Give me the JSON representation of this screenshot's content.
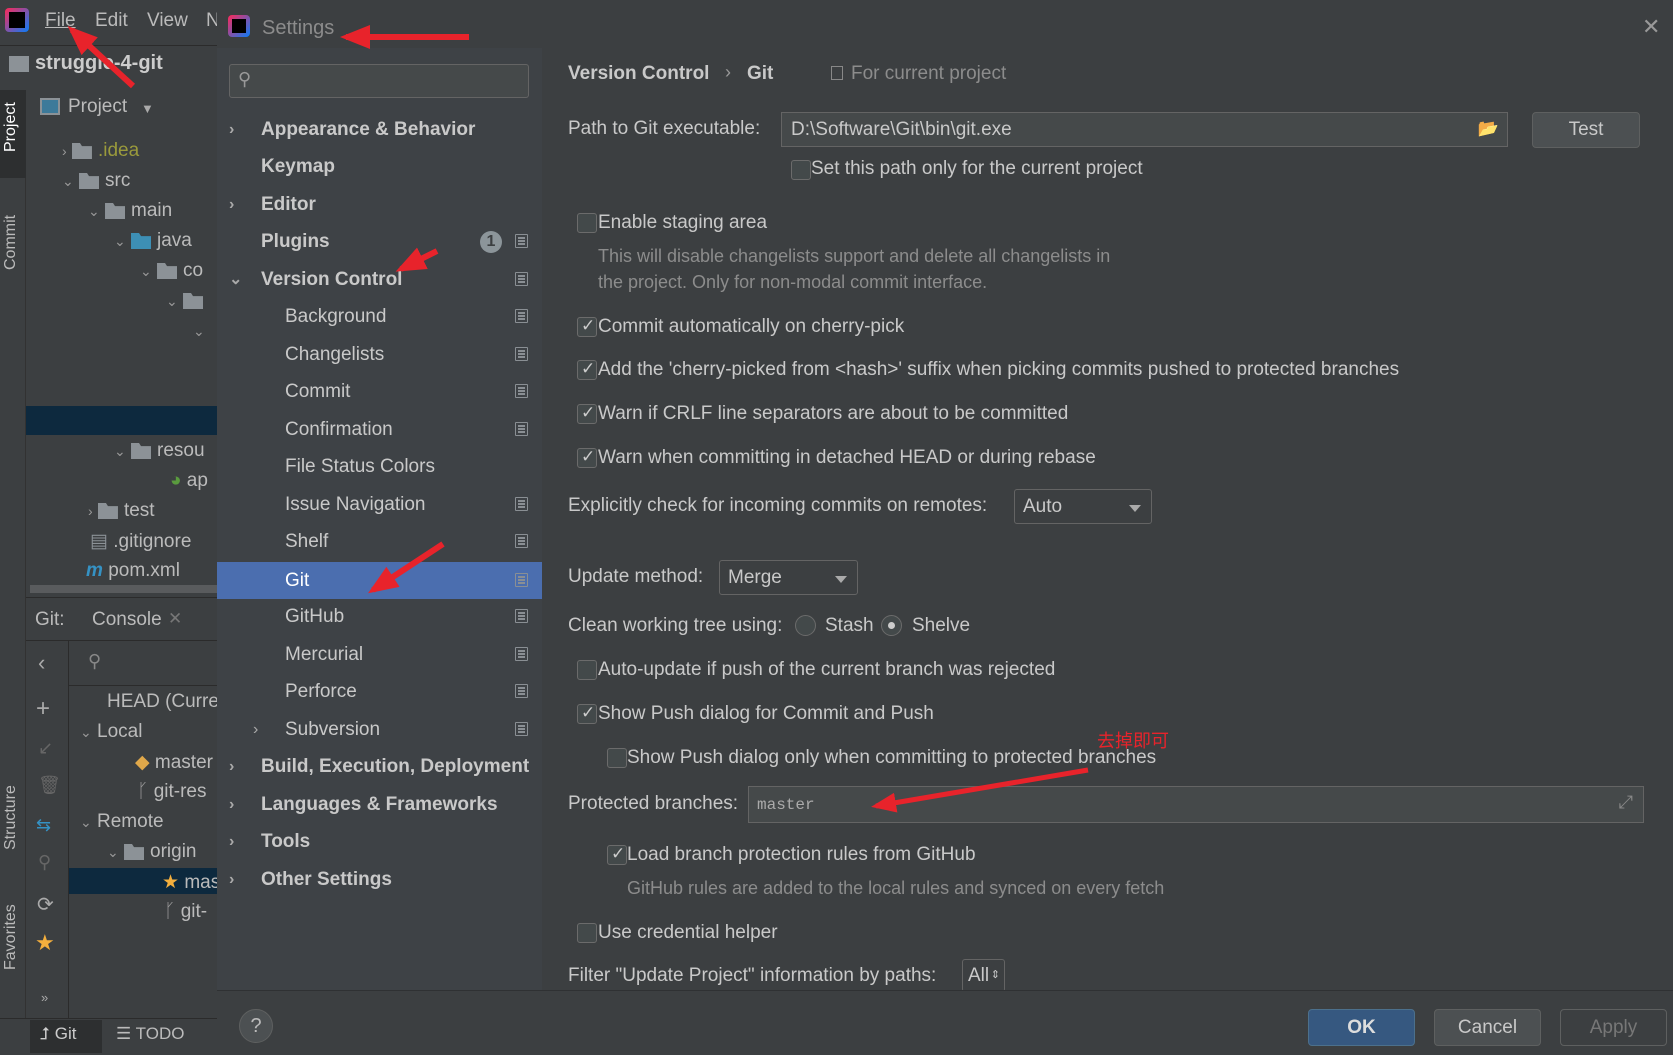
{
  "ide": {
    "menu": [
      "File",
      "Edit",
      "View",
      "N"
    ],
    "project_name": "struggle-4-git",
    "tool_strip": {
      "project": "Project",
      "commit": "Commit",
      "structure": "Structure",
      "favorites": "Favorites"
    },
    "project_view_label": "Project",
    "tree": [
      ".idea",
      "src",
      "main",
      "java",
      "co",
      "resou",
      "ap",
      "test",
      ".gitignore",
      "pom.xml"
    ],
    "git_panel": {
      "title": "Git:",
      "console_tab": "Console",
      "branches": [
        "HEAD (Curre",
        "Local",
        "master",
        "git-res",
        "Remote",
        "origin",
        "mas",
        "git-"
      ]
    },
    "bottom_tabs": {
      "git": "Git",
      "todo": "TODO"
    }
  },
  "dialog": {
    "title": "Settings",
    "search": {
      "value": "",
      "placeholder": ""
    },
    "tree": [
      {
        "label": "Appearance & Behavior"
      },
      {
        "label": "Keymap"
      },
      {
        "label": "Editor"
      },
      {
        "label": "Plugins",
        "badge": "1"
      },
      {
        "label": "Version Control"
      },
      {
        "label": "Background"
      },
      {
        "label": "Changelists"
      },
      {
        "label": "Commit"
      },
      {
        "label": "Confirmation"
      },
      {
        "label": "File Status Colors"
      },
      {
        "label": "Issue Navigation"
      },
      {
        "label": "Shelf"
      },
      {
        "label": "Git",
        "selected": true
      },
      {
        "label": "GitHub"
      },
      {
        "label": "Mercurial"
      },
      {
        "label": "Perforce"
      },
      {
        "label": "Subversion"
      },
      {
        "label": "Build, Execution, Deployment"
      },
      {
        "label": "Languages & Frameworks"
      },
      {
        "label": "Tools"
      },
      {
        "label": "Other Settings"
      }
    ],
    "breadcrumb": {
      "parent": "Version Control",
      "current": "Git",
      "scope": "For current project"
    },
    "git": {
      "path_label": "Path to Git executable:",
      "path_value": "D:\\Software\\Git\\bin\\git.exe",
      "test_button": "Test",
      "set_path_current": {
        "label": "Set this path only for the current project",
        "checked": false
      },
      "staging": {
        "label": "Enable staging area",
        "checked": false
      },
      "staging_desc": [
        "This will disable changelists support and delete all changelists in",
        "the project. Only for non-modal commit interface."
      ],
      "commit_cherry": {
        "label": "Commit automatically on cherry-pick",
        "checked": true
      },
      "cherry_suffix": {
        "label": "Add the 'cherry-picked from <hash>' suffix when picking commits pushed to protected branches",
        "checked": true
      },
      "warn_crlf": {
        "label": "Warn if CRLF line separators are about to be committed",
        "checked": true
      },
      "warn_detached": {
        "label": "Warn when committing in detached HEAD or during rebase",
        "checked": true
      },
      "incoming_label": "Explicitly check for incoming commits on remotes:",
      "incoming_value": "Auto",
      "update_label": "Update method:",
      "update_value": "Merge",
      "clean_label": "Clean working tree using:",
      "clean_options": [
        "Stash",
        "Shelve"
      ],
      "clean_selected": "Shelve",
      "auto_update": {
        "label": "Auto-update if push of the current branch was rejected",
        "checked": false
      },
      "show_push": {
        "label": "Show Push dialog for Commit and Push",
        "checked": true
      },
      "push_protected": {
        "label": "Show Push dialog only when committing to protected branches",
        "checked": false
      },
      "protected_label": "Protected branches:",
      "protected_value": "master",
      "load_rules": {
        "label": "Load branch protection rules from GitHub",
        "checked": true
      },
      "rules_desc": "GitHub rules are added to the local rules and synced on every fetch",
      "credential": {
        "label": "Use credential helper",
        "checked": false
      },
      "filter_label": "Filter \"Update Project\" information by paths:",
      "filter_value": "All"
    },
    "buttons": {
      "help": "?",
      "ok": "OK",
      "cancel": "Cancel",
      "apply": "Apply"
    }
  },
  "annotation": {
    "note": "去掉即可",
    "color": "#e8232b"
  },
  "colors": {
    "selection": "#4b6eaf",
    "ok_button": "#365880",
    "background": "#3c3f41"
  }
}
